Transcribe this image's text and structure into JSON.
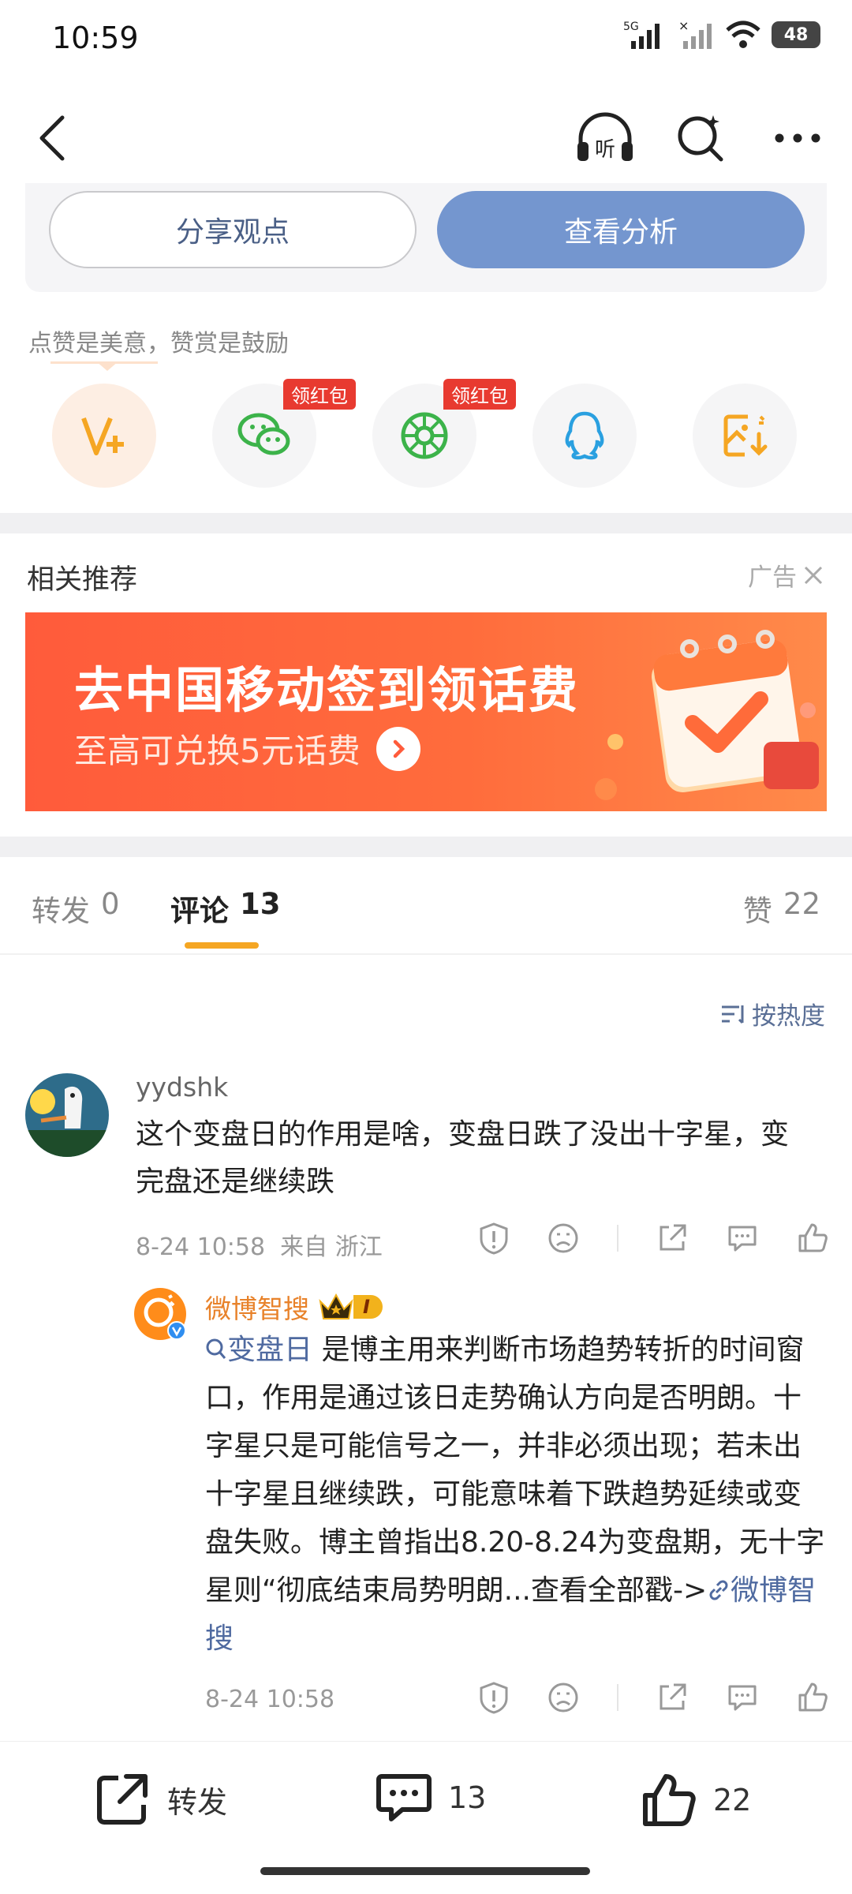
{
  "status_bar": {
    "time": "10:59",
    "network": "5G",
    "battery": "48"
  },
  "nav": {
    "listen_label": "听"
  },
  "share_card": {
    "share_btn": "分享观点",
    "analysis_btn": "查看分析"
  },
  "reward_hint": "点赞是美意，赞赏是鼓励",
  "share_targets": [
    {
      "icon": "v-plus-icon",
      "badge": ""
    },
    {
      "icon": "wechat-icon",
      "badge": "领红包"
    },
    {
      "icon": "moments-icon",
      "badge": "领红包"
    },
    {
      "icon": "qq-icon",
      "badge": ""
    },
    {
      "icon": "save-image-icon",
      "badge": ""
    }
  ],
  "recommend": {
    "title": "相关推荐",
    "ad_label": "广告"
  },
  "banner": {
    "title": "去中国移动签到领话费",
    "subtitle": "至高可兑换5元话费"
  },
  "tabs": {
    "repost_label": "转发",
    "repost_count": "0",
    "comment_label": "评论",
    "comment_count": "13",
    "like_label": "赞",
    "like_count": "22"
  },
  "sort_label": "按热度",
  "comment": {
    "username": "yydshk",
    "text": "这个变盘日的作用是啥，变盘日跌了没出十字星，变完盘还是继续跌",
    "time": "8-24 10:58",
    "location": "来自 浙江"
  },
  "reply": {
    "username": "微博智搜",
    "level_badge": "I",
    "topic": "变盘日",
    "text": " 是博主用来判断市场趋势转折的时间窗口，作用是通过该日走势确认方向是否明朗。十字星只是可能信号之一，并非必须出现；若未出十字星且继续跌，可能意味着下跌趋势延续或变盘失败。博主曾指出8.20-8.24为变盘期，无十字星则“彻底结束局势明朗...查看全部戳->",
    "link": "微博智搜",
    "time": "8-24 10:58"
  },
  "bottom_bar": {
    "repost_label": "转发",
    "comment_count": "13",
    "like_count": "22"
  }
}
